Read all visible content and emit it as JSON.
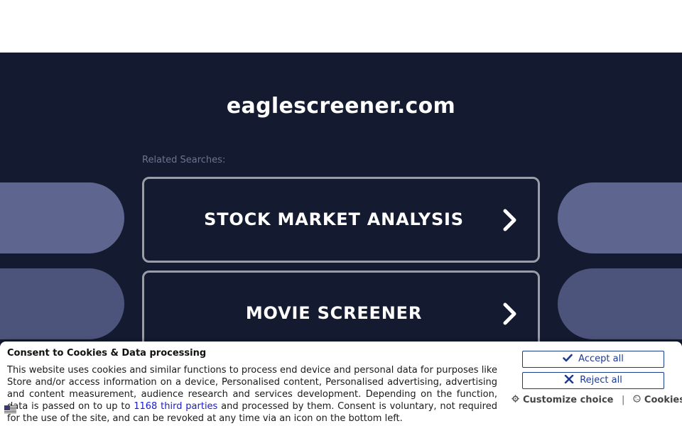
{
  "page": {
    "domain": "eaglescreener.com",
    "related_label": "Related Searches:"
  },
  "searches": [
    {
      "label": "STOCK MARKET ANALYSIS",
      "icon": "chevron-right-icon"
    },
    {
      "label": "MOVIE SCREENER",
      "icon": "chevron-right-icon"
    }
  ],
  "consent": {
    "title": "Consent to Cookies & Data processing",
    "body_before_link": "This website uses cookies and similar functions to process end device and personal data for purposes like Store and/or access information on a device, Personalised content, Personalised advertising, advertising and content measurement, audience research and services development. Depending on the function, data is passed on to up to ",
    "link_text": "1168 third parties",
    "body_after_link": " and processed by them. Consent is voluntary, not required for the use of the site, and can be revoked at any time via an icon on the bottom left.",
    "accept_label": "Accept all",
    "reject_label": "Reject all",
    "customize_label": "Customize choice",
    "separator": "|",
    "cookies_label": "Cookies"
  },
  "colors": {
    "background": "#141a30",
    "button_text": "#1f3b8d",
    "link": "#1a1ad0"
  }
}
